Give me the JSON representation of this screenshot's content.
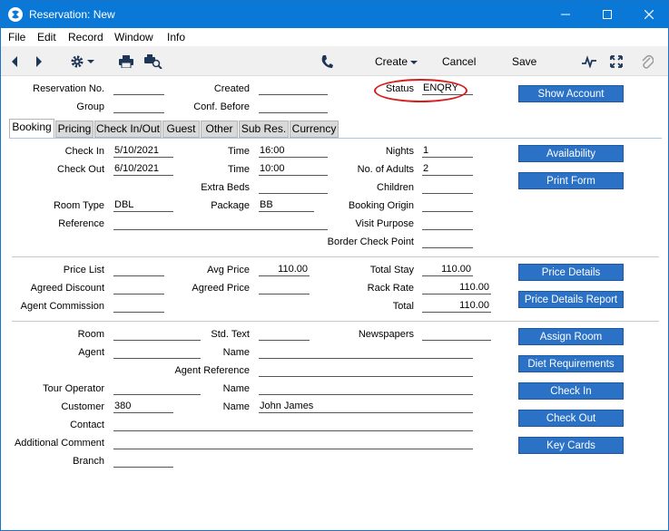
{
  "window": {
    "title": "Reservation: New",
    "accent": "#0a78d7"
  },
  "menu": [
    "File",
    "Edit",
    "Record",
    "Window",
    "Info"
  ],
  "toolbar": {
    "create": "Create",
    "cancel": "Cancel",
    "save": "Save"
  },
  "header": {
    "reservation_no_label": "Reservation No.",
    "reservation_no": "",
    "group_label": "Group",
    "group": "",
    "created_label": "Created",
    "created": "",
    "conf_before_label": "Conf. Before",
    "conf_before": "",
    "status_label": "Status",
    "status": "ENQRY",
    "show_account": "Show Account"
  },
  "tabs": [
    "Booking",
    "Pricing",
    "Check In/Out",
    "Guest",
    "Other",
    "Sub Res.",
    "Currency"
  ],
  "booking": {
    "check_in_label": "Check In",
    "check_in": "5/10/2021",
    "check_out_label": "Check Out",
    "check_out": "6/10/2021",
    "time1_label": "Time",
    "time1": "16:00",
    "time2_label": "Time",
    "time2": "10:00",
    "extra_beds_label": "Extra Beds",
    "extra_beds": "",
    "nights_label": "Nights",
    "nights": "1",
    "adults_label": "No. of Adults",
    "adults": "2",
    "children_label": "Children",
    "children": "",
    "room_type_label": "Room Type",
    "room_type": "DBL",
    "package_label": "Package",
    "package": "BB",
    "booking_origin_label": "Booking Origin",
    "booking_origin": "",
    "reference_label": "Reference",
    "reference": "",
    "visit_purpose_label": "Visit Purpose",
    "visit_purpose": "",
    "border_check_label": "Border Check Point",
    "border_check": "",
    "availability": "Availability",
    "print_form": "Print Form"
  },
  "pricing": {
    "price_list_label": "Price List",
    "price_list": "",
    "agreed_discount_label": "Agreed Discount",
    "agreed_discount": "",
    "agent_commission_label": "Agent Commission",
    "agent_commission": "",
    "avg_price_label": "Avg Price",
    "avg_price": "110.00",
    "agreed_price_label": "Agreed Price",
    "agreed_price": "",
    "total_stay_label": "Total Stay",
    "total_stay": "110.00",
    "rack_rate_label": "Rack Rate",
    "rack_rate": "110.00",
    "total_label": "Total",
    "total": "110.00",
    "price_details": "Price Details",
    "price_details_report": "Price Details Report"
  },
  "guest": {
    "room_label": "Room",
    "room": "",
    "std_text_label": "Std. Text",
    "std_text": "",
    "newspapers_label": "Newspapers",
    "newspapers": "",
    "agent_label": "Agent",
    "agent": "",
    "name1_label": "Name",
    "name1": "",
    "agent_reference_label": "Agent Reference",
    "agent_reference": "",
    "tour_operator_label": "Tour Operator",
    "tour_operator": "",
    "name2_label": "Name",
    "name2": "",
    "customer_label": "Customer",
    "customer": "380",
    "name3_label": "Name",
    "name3": "John James",
    "contact_label": "Contact",
    "contact": "",
    "additional_comment_label": "Additional Comment",
    "additional_comment": "",
    "branch_label": "Branch",
    "branch": "",
    "assign_room": "Assign Room",
    "diet_requirements": "Diet Requirements",
    "check_in_btn": "Check In",
    "check_out_btn": "Check Out",
    "key_cards": "Key Cards"
  }
}
